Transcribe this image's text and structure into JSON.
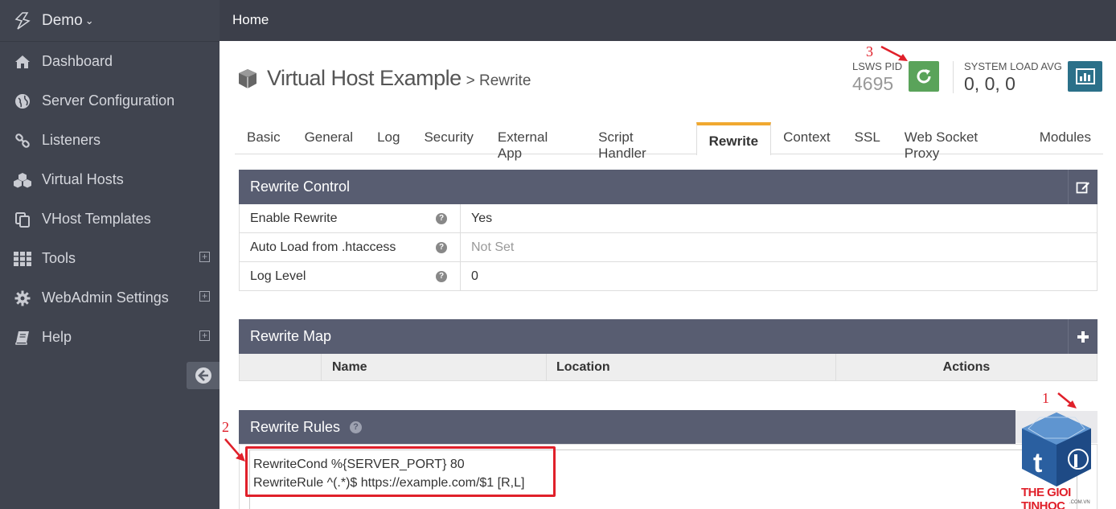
{
  "sidebar": {
    "brand": "Demo",
    "items": [
      {
        "label": "Dashboard",
        "icon": "home-icon"
      },
      {
        "label": "Server Configuration",
        "icon": "globe-icon"
      },
      {
        "label": "Listeners",
        "icon": "link-icon"
      },
      {
        "label": "Virtual Hosts",
        "icon": "cubes-icon"
      },
      {
        "label": "VHost Templates",
        "icon": "copy-icon"
      },
      {
        "label": "Tools",
        "icon": "grid-icon",
        "expandable": true
      },
      {
        "label": "WebAdmin Settings",
        "icon": "gear-icon",
        "expandable": true
      },
      {
        "label": "Help",
        "icon": "book-icon",
        "expandable": true
      }
    ]
  },
  "topbar": {
    "breadcrumb": "Home"
  },
  "header": {
    "title": "Virtual Host Example",
    "subtitle": "> Rewrite",
    "pid_label": "LSWS PID",
    "pid_value": "4695",
    "load_label": "SYSTEM LOAD AVG",
    "load_value": "0, 0, 0"
  },
  "tabs": [
    "Basic",
    "General",
    "Log",
    "Security",
    "External App",
    "Script Handler",
    "Rewrite",
    "Context",
    "SSL",
    "Web Socket Proxy",
    "Modules"
  ],
  "active_tab": "Rewrite",
  "rewrite_control": {
    "title": "Rewrite Control",
    "rows": [
      {
        "key": "Enable Rewrite",
        "value": "Yes",
        "muted": false
      },
      {
        "key": "Auto Load from .htaccess",
        "value": "Not Set",
        "muted": true
      },
      {
        "key": "Log Level",
        "value": "0",
        "muted": false
      }
    ]
  },
  "rewrite_map": {
    "title": "Rewrite Map",
    "columns": [
      "",
      "Name",
      "Location",
      "Actions"
    ]
  },
  "rewrite_rules": {
    "title": "Rewrite Rules",
    "lines": [
      "RewriteCond %{SERVER_PORT} 80",
      "RewriteRule ^(.*)$ https://example.com/$1 [R,L]"
    ]
  },
  "annotations": {
    "a1": "1",
    "a2": "2",
    "a3": "3"
  },
  "watermark": {
    "text": "THE GIOI TINHOC",
    "sub": ".COM.VN"
  },
  "colors": {
    "sidebar": "#40444f",
    "panel_header": "#585d71",
    "active_tab": "#f0a830",
    "restart": "#5aa35a",
    "stats": "#2b7089",
    "annotation": "#e0202a"
  }
}
